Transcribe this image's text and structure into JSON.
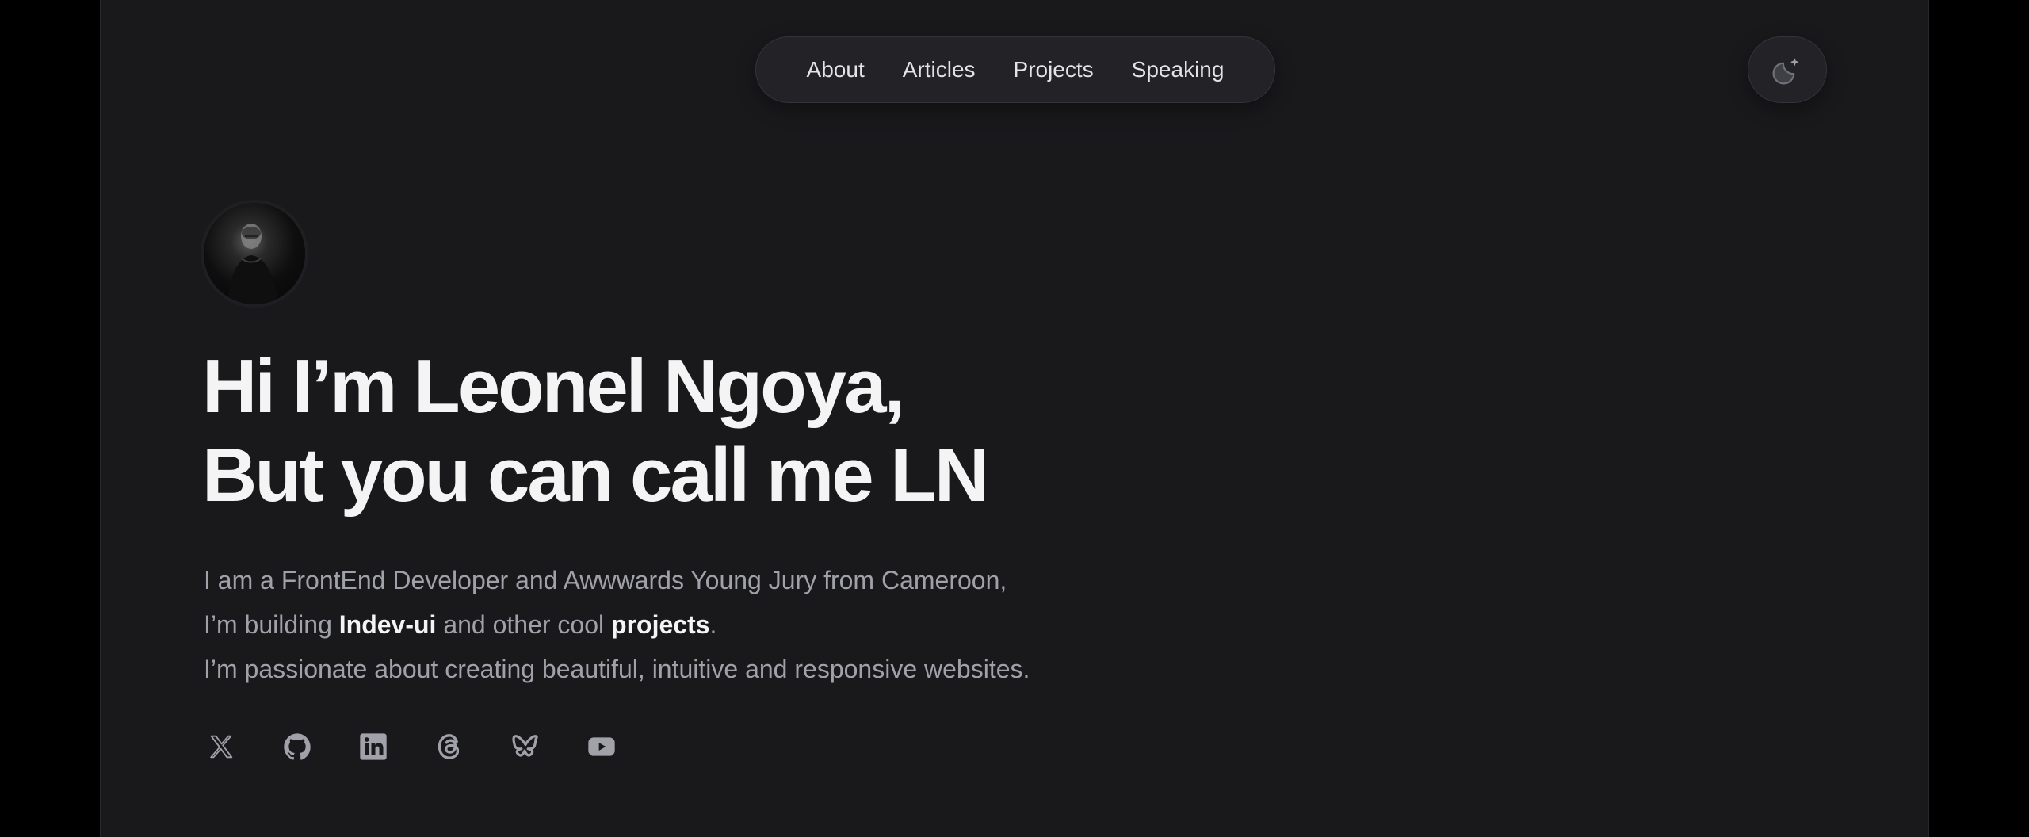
{
  "nav": {
    "items": [
      {
        "label": "About"
      },
      {
        "label": "Articles"
      },
      {
        "label": "Projects"
      },
      {
        "label": "Speaking"
      }
    ]
  },
  "theme_toggle": {
    "icon": "moon-sparkle-icon"
  },
  "hero": {
    "avatar_icon": "profile-photo",
    "headline_line1": "Hi I’m Leonel Ngoya,",
    "headline_line2": "But you can call me LN",
    "intro_line1": "I am a FrontEnd Developer and Awwwards Young Jury from Cameroon,",
    "intro_line2_prefix": "I’m building ",
    "intro_line2_link1": "Indev-ui",
    "intro_line2_mid": " and other cool ",
    "intro_line2_link2": "projects",
    "intro_line2_suffix": ".",
    "intro_line3": "I’m passionate about creating beautiful, intuitive and responsive websites."
  },
  "socials": [
    {
      "icon": "x-twitter-icon"
    },
    {
      "icon": "github-icon"
    },
    {
      "icon": "linkedin-icon"
    },
    {
      "icon": "threads-icon"
    },
    {
      "icon": "bluesky-icon"
    },
    {
      "icon": "youtube-icon"
    }
  ],
  "colors": {
    "background": "#19191c",
    "outer": "#000000",
    "text_primary": "#f4f4f5",
    "text_secondary": "#a1a1aa",
    "icon": "#a1a1aa"
  }
}
